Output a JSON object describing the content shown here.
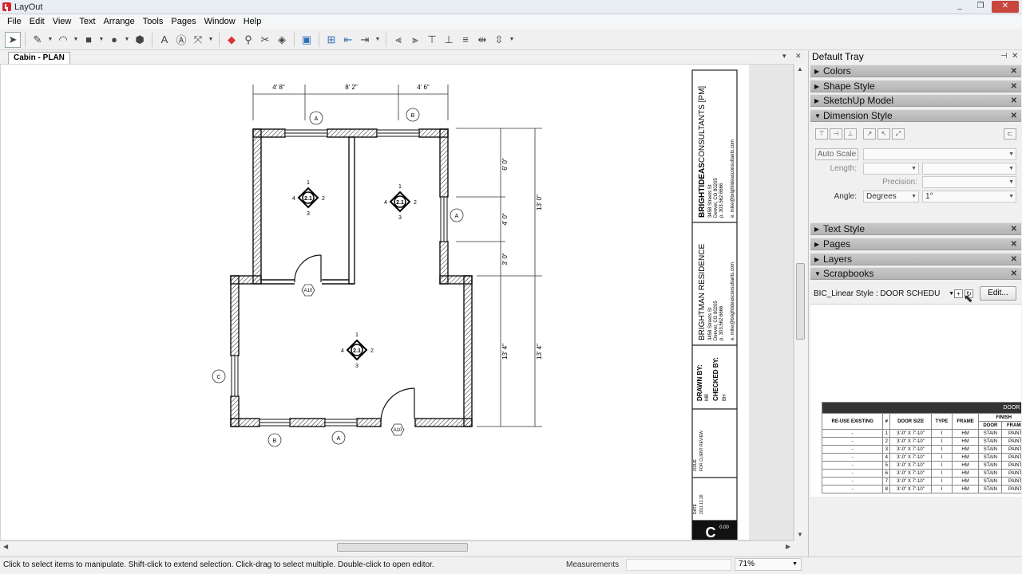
{
  "window": {
    "title": "LayOut",
    "controls": [
      "_",
      "❐",
      "✕"
    ]
  },
  "menu": [
    "File",
    "Edit",
    "View",
    "Text",
    "Arrange",
    "Tools",
    "Pages",
    "Window",
    "Help"
  ],
  "toolbar": {
    "icons": [
      "select-tool-icon",
      "line-tool-icon",
      "arc-tool-icon",
      "rectangle-tool-icon",
      "circle-tool-icon",
      "polygon-tool-icon",
      "text-tool-icon",
      "label-tool-icon",
      "dimension-tool-icon",
      "eraser-tool-icon",
      "style-tool-icon",
      "split-tool-icon",
      "join-tool-icon",
      "presentation-icon",
      "add-page-icon",
      "previous-page-icon",
      "next-page-icon",
      "align-left-icon",
      "align-right-icon",
      "align-top-icon",
      "align-bottom-icon",
      "align-center-icon",
      "space-horizontal-icon",
      "space-vertical-icon"
    ]
  },
  "document": {
    "tab": "Cabin - PLAN"
  },
  "drawing": {
    "dims_top": [
      "4' 8\"",
      "8' 2\"",
      "4' 6\""
    ],
    "dims_right_inner": [
      "6' 0\"",
      "4' 0\"",
      "3' 0\"",
      "13' 4\""
    ],
    "dims_right_outer": [
      "13' 0\"",
      "13' 4\""
    ],
    "grid_bubbles": {
      "a_top": "A",
      "b_top": "B",
      "a_right": "A",
      "c_left": "C",
      "b_bottom": "B",
      "a_bottom": "A"
    },
    "hex_tags": [
      "A10",
      "A10"
    ],
    "elevation_tag": {
      "center": "2.1",
      "n1": "1",
      "n2": "2",
      "n3": "3",
      "n4": "4"
    }
  },
  "titleblock": {
    "firm_bold": "BRIGHTIDEAS",
    "firm_rest": "CONSULTANTS [PM]",
    "firm_addr": [
      "3458 Streets St",
      "Denver, CO 80205",
      "p. 303.562.6666",
      "e. mike@brightideasconsultants.com"
    ],
    "project_title": "BRIGHTMAN RESIDENCE",
    "project_addr": [
      "3458 Streets St",
      "Denver, CO 80205",
      "p. 303.562.6666",
      "e. mike@brightideasconsultants.com"
    ],
    "drawn_label": "DRAWN BY:",
    "drawn_value": "MB",
    "checked_label": "CHECKED BY:",
    "checked_value": "BH",
    "issue_label": "ISSUE",
    "issue_value": "FOR CLIENT REVIEW",
    "date_label": "DATE",
    "date_value": "2011.12.28",
    "sheet_letter": "C",
    "sheet_number": "0.00"
  },
  "tray": {
    "title": "Default Tray",
    "panels": {
      "colors": "Colors",
      "shape_style": "Shape Style",
      "sketchup_model": "SketchUp Model",
      "dimension_style": "Dimension Style",
      "text_style": "Text Style",
      "pages": "Pages",
      "layers": "Layers",
      "scrapbooks": "Scrapbooks"
    },
    "dimension": {
      "auto_scale": "Auto Scale",
      "length_label": "Length:",
      "precision_label": "Precision:",
      "angle_label": "Angle:",
      "angle_value": "Degrees",
      "angle_precision": "1°"
    },
    "scrapbook": {
      "selected": "BIC_Linear Style : DOOR SCHEDU",
      "edit": "Edit..."
    }
  },
  "schedule": {
    "title": "DOOR S",
    "headers": [
      "RE-USE EXISTING",
      "#",
      "DOOR SIZE",
      "TYPE",
      "FRAME",
      "FINISH"
    ],
    "finish_sub": [
      "DOOR",
      "FRAME"
    ],
    "rows": [
      [
        "-",
        "1",
        "3'-0\" X 7'-10\"",
        "I",
        "HM",
        "STAIN",
        "PAINT"
      ],
      [
        "-",
        "2",
        "3'-0\" X 7'-10\"",
        "I",
        "HM",
        "STAIN",
        "PAINT"
      ],
      [
        "-",
        "3",
        "3'-0\" X 7'-10\"",
        "I",
        "HM",
        "STAIN",
        "PAINT"
      ],
      [
        "-",
        "4",
        "3'-0\" X 7'-10\"",
        "I",
        "HM",
        "STAIN",
        "PAINT"
      ],
      [
        "-",
        "5",
        "3'-0\" X 7'-10\"",
        "I",
        "HM",
        "STAIN",
        "PAINT"
      ],
      [
        "-",
        "6",
        "3'-0\" X 7'-10\"",
        "I",
        "HM",
        "STAIN",
        "PAINT"
      ],
      [
        "-",
        "7",
        "3'-0\" X 7'-10\"",
        "I",
        "HM",
        "STAIN",
        "PAINT"
      ],
      [
        "-",
        "8",
        "3'-0\" X 7'-10\"",
        "I",
        "HM",
        "STAIN",
        "PAINT"
      ]
    ]
  },
  "status": {
    "hint": "Click to select items to manipulate. Shift-click to extend selection. Click-drag to select multiple. Double-click to open editor.",
    "measurements_label": "Measurements",
    "zoom": "71%"
  }
}
